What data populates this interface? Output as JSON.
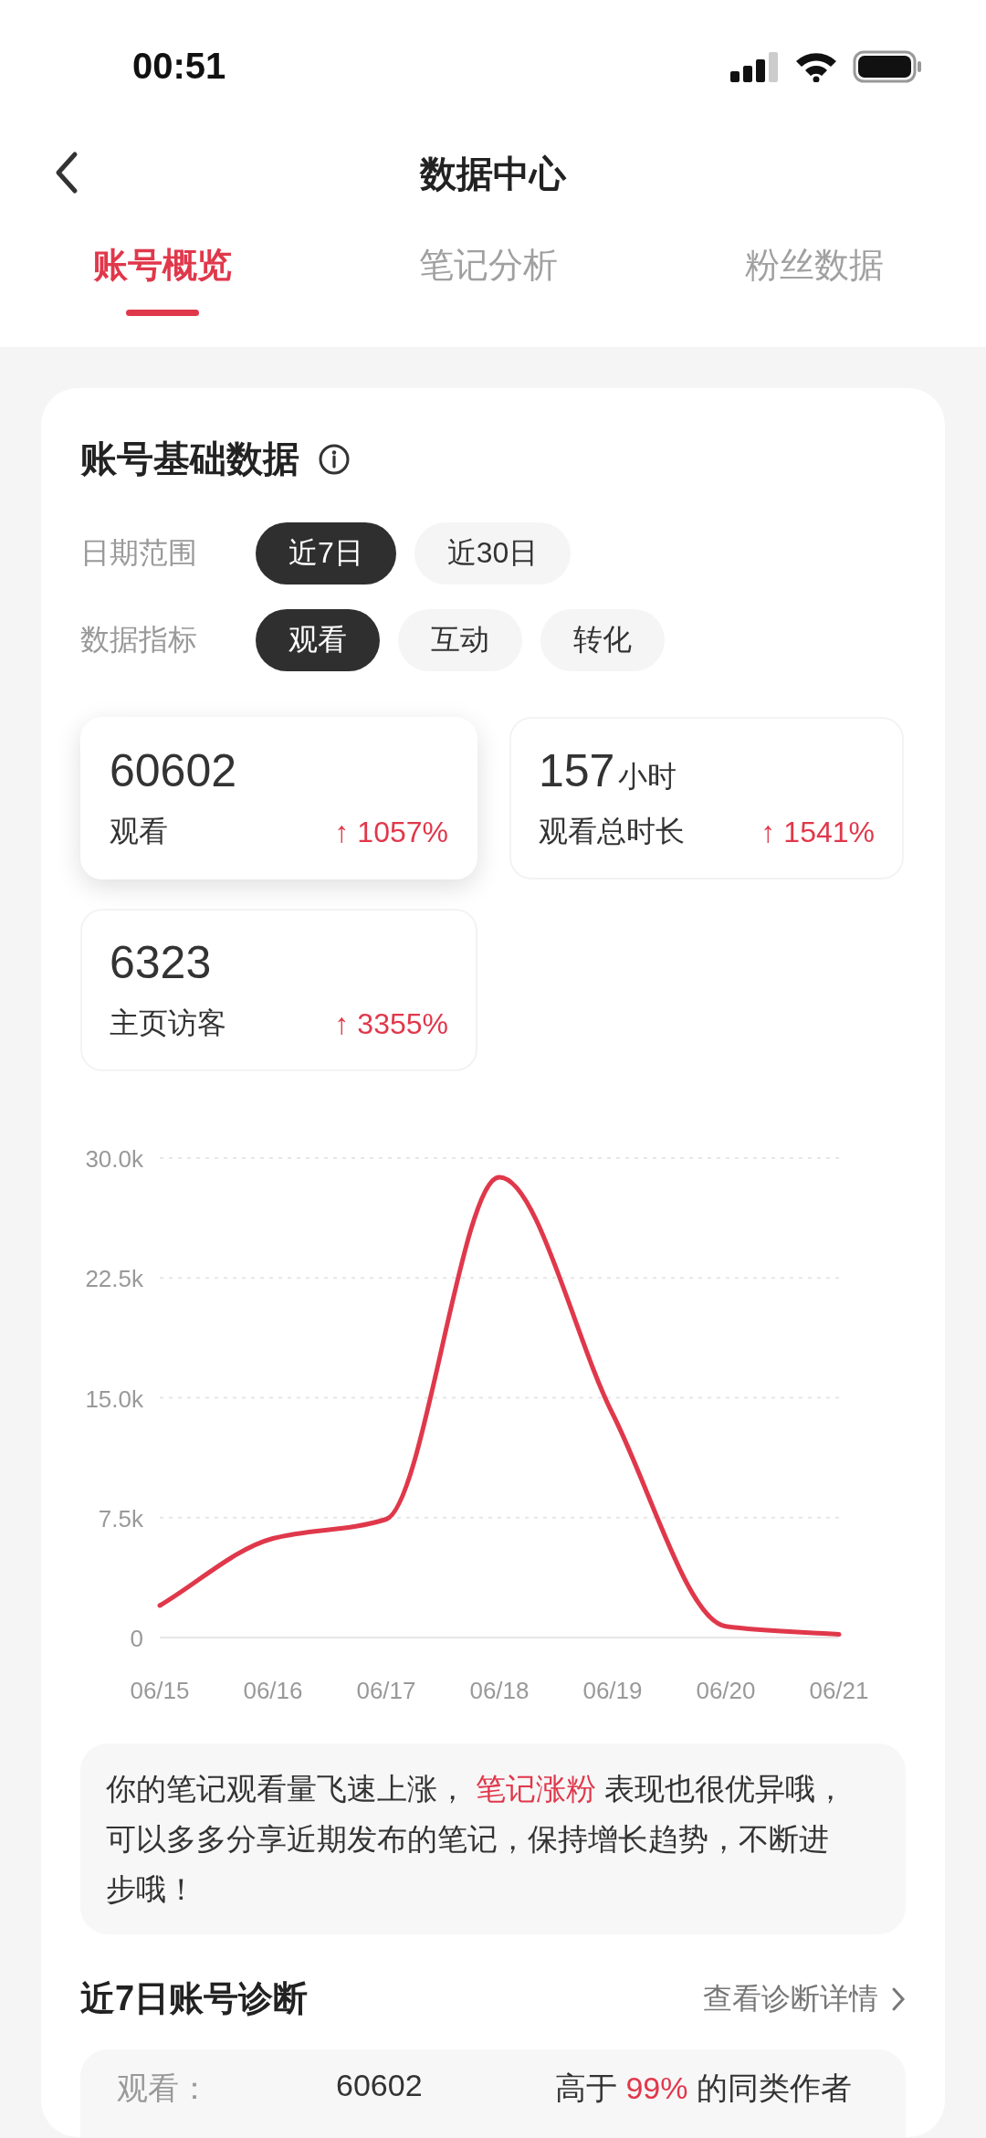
{
  "status_bar": {
    "time": "00:51"
  },
  "nav": {
    "title": "数据中心"
  },
  "tabs": [
    {
      "label": "账号概览",
      "selected": true
    },
    {
      "label": "笔记分析",
      "selected": false
    },
    {
      "label": "粉丝数据",
      "selected": false
    }
  ],
  "card": {
    "title": "账号基础数据",
    "filters": [
      {
        "label": "日期范围",
        "options": [
          {
            "label": "近7日",
            "selected": true
          },
          {
            "label": "近30日",
            "selected": false
          }
        ]
      },
      {
        "label": "数据指标",
        "options": [
          {
            "label": "观看",
            "selected": true
          },
          {
            "label": "互动",
            "selected": false
          },
          {
            "label": "转化",
            "selected": false
          }
        ]
      }
    ],
    "stats": [
      {
        "value": "60602",
        "label": "观看",
        "change": "↑ 1057%",
        "selected": true
      },
      {
        "value": "157",
        "unit": "小时",
        "label": "观看总时长",
        "change": "↑ 1541%",
        "selected": false
      },
      {
        "value": "6323",
        "label": "主页访客",
        "change": "↑ 3355%",
        "selected": false
      }
    ],
    "chart_data": {
      "type": "line",
      "categories": [
        "06/15",
        "06/16",
        "06/17",
        "06/18",
        "06/19",
        "06/20",
        "06/21"
      ],
      "grid": true,
      "series": [
        {
          "color": "#e0384b",
          "values": [
            2000,
            6200,
            7400,
            28800,
            14000,
            700,
            200
          ]
        }
      ],
      "ylim": [
        0,
        30000
      ],
      "yticks": [
        {
          "value": 0,
          "label": "0"
        },
        {
          "value": 7500,
          "label": "7.5k"
        },
        {
          "value": 15000,
          "label": "15.0k"
        },
        {
          "value": 22500,
          "label": "22.5k"
        },
        {
          "value": 30000,
          "label": "30.0k"
        }
      ]
    }
  },
  "comment": [
    {
      "text": "你的笔记观看量飞速上涨， ",
      "highlight": false
    },
    {
      "text": "笔记涨粉",
      "highlight": true
    },
    {
      "text": " 表现也很优异哦，可以多多分享近期发布的笔记，保持增长趋势，不断进步哦！",
      "highlight": false
    }
  ],
  "diagnosis": {
    "title": "近7日账号诊断",
    "link": "查看诊断详情",
    "rows": [
      {
        "label": "观看：",
        "value": "60602",
        "compare": [
          {
            "text": "高于 ",
            "highlight": false
          },
          {
            "text": "99%",
            "highlight": true
          },
          {
            "text": " 的同类作者",
            "highlight": false
          }
        ]
      }
    ]
  }
}
